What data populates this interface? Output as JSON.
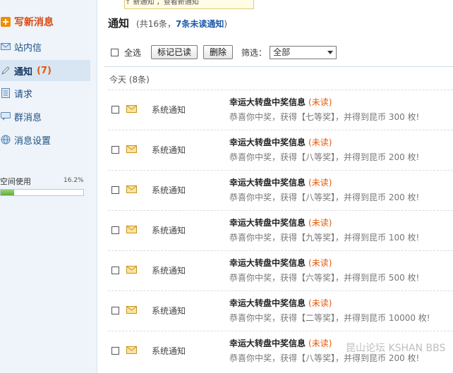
{
  "tooltip": {
    "text": "↑ 新通知 ，查看新通知"
  },
  "sidebar": {
    "compose_label": "写新消息",
    "inbox_label": "站内信",
    "notice_label": "通知",
    "notice_count": "(7)",
    "request_label": "请求",
    "group_label": "群消息",
    "settings_label": "消息设置",
    "space_label": "空间使用",
    "space_percent_text": "16.2%",
    "space_percent_value": 0.162
  },
  "header": {
    "title": "通知",
    "summary_prefix": "(共16条，",
    "unread_link": "7条未读通知",
    "summary_suffix": ")"
  },
  "toolbar": {
    "select_all_label": "全选",
    "mark_read_button": "标记已读",
    "delete_button": "删除",
    "filter_label": "筛选：",
    "filter_value": "全部"
  },
  "list": {
    "group_label": "今天 (8条)",
    "rows": [
      {
        "type": "系统通知",
        "title": "幸运大转盘中奖信息",
        "status": "(未读)",
        "body": "恭喜你中奖，获得【七等奖】，并得到昆币 300 枚!"
      },
      {
        "type": "系统通知",
        "title": "幸运大转盘中奖信息",
        "status": "(未读)",
        "body": "恭喜你中奖，获得【八等奖】，并得到昆币 200 枚!"
      },
      {
        "type": "系统通知",
        "title": "幸运大转盘中奖信息",
        "status": "(未读)",
        "body": "恭喜你中奖，获得【八等奖】，并得到昆币 200 枚!"
      },
      {
        "type": "系统通知",
        "title": "幸运大转盘中奖信息",
        "status": "(未读)",
        "body": "恭喜你中奖，获得【九等奖】，并得到昆币 100 枚!"
      },
      {
        "type": "系统通知",
        "title": "幸运大转盘中奖信息",
        "status": "(未读)",
        "body": "恭喜你中奖，获得【六等奖】，并得到昆币 500 枚!"
      },
      {
        "type": "系统通知",
        "title": "幸运大转盘中奖信息",
        "status": "(未读)",
        "body": "恭喜你中奖，获得【二等奖】，并得到昆币 10000 枚!"
      },
      {
        "type": "系统通知",
        "title": "幸运大转盘中奖信息",
        "status": "(未读)",
        "body": "恭喜你中奖，获得【八等奖】，并得到昆币 200 枚!"
      }
    ]
  },
  "watermark": {
    "text": "昆山论坛 KSHAN BBS"
  },
  "colors": {
    "accent_orange": "#e8590c",
    "link_blue": "#1e5aa8",
    "sidebar_bg": "#eef4fa",
    "sidebar_active_bg": "#d8e6f3"
  }
}
